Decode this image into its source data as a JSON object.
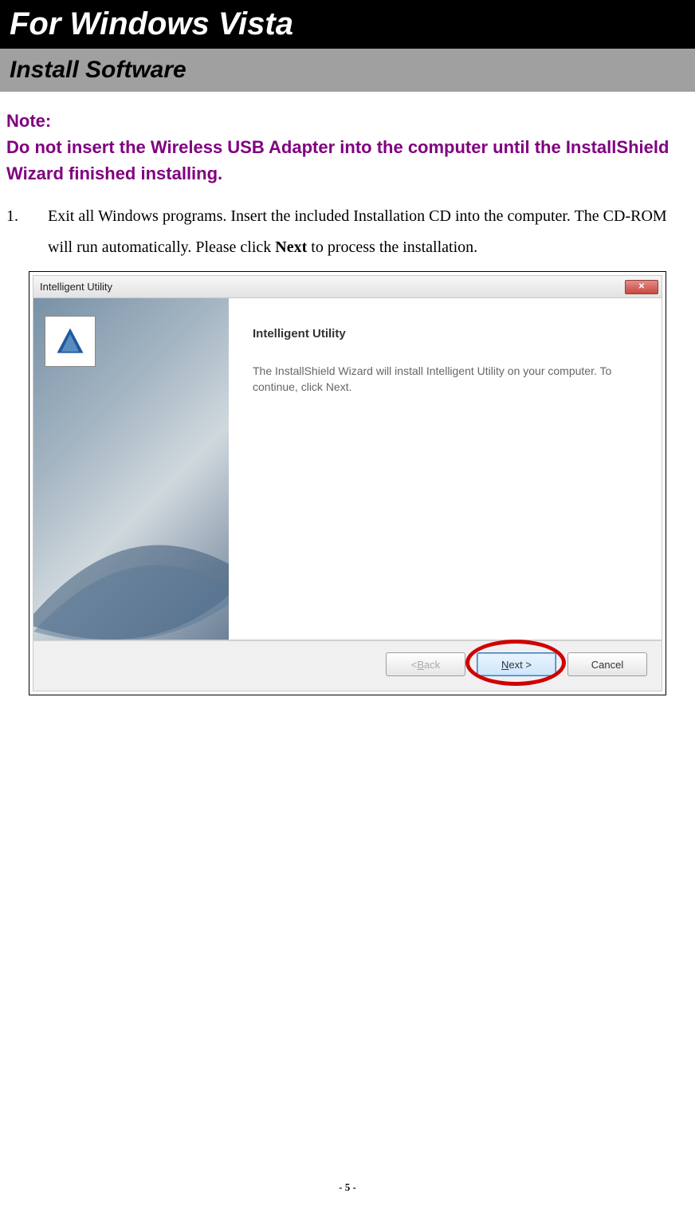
{
  "page": {
    "title": "For Windows Vista",
    "subtitle": "Install Software",
    "note_label": "Note:",
    "note_body": "Do not insert the Wireless USB Adapter into the computer until the InstallShield Wizard finished installing.",
    "step_number": "1.",
    "step_text_before": "Exit all Windows programs. Insert the included Installation CD into the computer. The CD-ROM will run automatically. Please click ",
    "step_text_bold": "Next",
    "step_text_after": " to process the installation.",
    "page_number": "- 5 -"
  },
  "dialog": {
    "window_title": "Intelligent Utility",
    "close_glyph": "✕",
    "heading": "Intelligent Utility",
    "description": "The InstallShield Wizard will install Intelligent Utility on your computer.  To continue, click Next.",
    "buttons": {
      "back_prefix": "< ",
      "back_access": "B",
      "back_suffix": "ack",
      "next_prefix": "",
      "next_access": "N",
      "next_suffix": "ext >",
      "cancel": "Cancel"
    }
  }
}
